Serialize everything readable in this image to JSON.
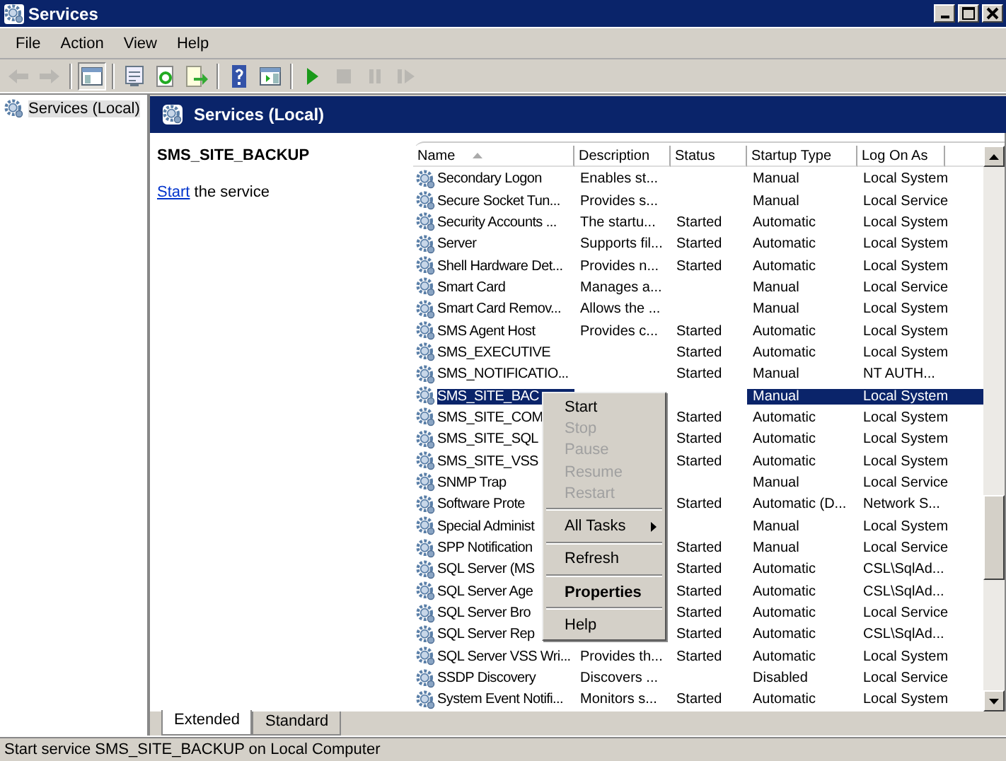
{
  "window": {
    "title": "Services"
  },
  "menu_bar": [
    "File",
    "Action",
    "View",
    "Help"
  ],
  "toolbar": [
    {
      "kind": "back",
      "disabled": true
    },
    {
      "kind": "forward",
      "disabled": true
    },
    {
      "kind": "sep"
    },
    {
      "kind": "tree",
      "disabled": false
    },
    {
      "kind": "sep"
    },
    {
      "kind": "props",
      "disabled": false
    },
    {
      "kind": "refresh",
      "disabled": false
    },
    {
      "kind": "export",
      "disabled": false
    },
    {
      "kind": "sep"
    },
    {
      "kind": "help",
      "disabled": false
    },
    {
      "kind": "pane",
      "disabled": false
    },
    {
      "kind": "sep"
    },
    {
      "kind": "play",
      "disabled": false
    },
    {
      "kind": "stop",
      "disabled": true
    },
    {
      "kind": "pause",
      "disabled": true
    },
    {
      "kind": "resume",
      "disabled": true
    }
  ],
  "tree": {
    "items": [
      {
        "label": "Services (Local)",
        "selected": true
      }
    ]
  },
  "header": {
    "title": "Services (Local)"
  },
  "details": {
    "title": "SMS_SITE_BACKUP",
    "link": "Start",
    "text": "the service"
  },
  "table": {
    "columns": [
      "Name",
      "Description",
      "Status",
      "Startup Type",
      "Log On As"
    ],
    "rows": [
      {
        "name": "Secondary Logon",
        "description": "Enables st...",
        "status": "",
        "startup": "Manual",
        "logon": "Local System",
        "selected": false
      },
      {
        "name": "Secure Socket Tun...",
        "description": "Provides s...",
        "status": "",
        "startup": "Manual",
        "logon": "Local Service",
        "selected": false
      },
      {
        "name": "Security Accounts ...",
        "description": "The startu...",
        "status": "Started",
        "startup": "Automatic",
        "logon": "Local System",
        "selected": false
      },
      {
        "name": "Server",
        "description": "Supports fil...",
        "status": "Started",
        "startup": "Automatic",
        "logon": "Local System",
        "selected": false
      },
      {
        "name": "Shell Hardware Det...",
        "description": "Provides n...",
        "status": "Started",
        "startup": "Automatic",
        "logon": "Local System",
        "selected": false
      },
      {
        "name": "Smart Card",
        "description": "Manages a...",
        "status": "",
        "startup": "Manual",
        "logon": "Local Service",
        "selected": false
      },
      {
        "name": "Smart Card Remov...",
        "description": "Allows the ...",
        "status": "",
        "startup": "Manual",
        "logon": "Local System",
        "selected": false
      },
      {
        "name": "SMS Agent Host",
        "description": "Provides c...",
        "status": "Started",
        "startup": "Automatic",
        "logon": "Local System",
        "selected": false
      },
      {
        "name": "SMS_EXECUTIVE",
        "description": "",
        "status": "Started",
        "startup": "Automatic",
        "logon": "Local System",
        "selected": false
      },
      {
        "name": "SMS_NOTIFICATIO...",
        "description": "",
        "status": "Started",
        "startup": "Manual",
        "logon": "NT AUTH...",
        "selected": false
      },
      {
        "name": "SMS_SITE_BAC",
        "description": "",
        "status": "",
        "startup": "Manual",
        "logon": "Local System",
        "selected": true
      },
      {
        "name": "SMS_SITE_COM",
        "description": "",
        "status": "Started",
        "startup": "Automatic",
        "logon": "Local System",
        "selected": false
      },
      {
        "name": "SMS_SITE_SQL",
        "description": "",
        "status": "Started",
        "startup": "Automatic",
        "logon": "Local System",
        "selected": false
      },
      {
        "name": "SMS_SITE_VSS",
        "description": "",
        "status": "Started",
        "startup": "Automatic",
        "logon": "Local System",
        "selected": false
      },
      {
        "name": "SNMP Trap",
        "description": "",
        "status": "",
        "startup": "Manual",
        "logon": "Local Service",
        "selected": false
      },
      {
        "name": "Software Prote",
        "description": "",
        "status": "Started",
        "startup": "Automatic (D...",
        "logon": "Network S...",
        "selected": false
      },
      {
        "name": "Special Administ",
        "description": "",
        "status": "",
        "startup": "Manual",
        "logon": "Local System",
        "selected": false
      },
      {
        "name": "SPP Notification",
        "description": "",
        "status": "Started",
        "startup": "Manual",
        "logon": "Local Service",
        "selected": false
      },
      {
        "name": "SQL Server (MS",
        "description": "",
        "status": "Started",
        "startup": "Automatic",
        "logon": "CSL\\SqlAd...",
        "selected": false
      },
      {
        "name": "SQL Server Age",
        "description": "",
        "status": "Started",
        "startup": "Automatic",
        "logon": "CSL\\SqlAd...",
        "selected": false
      },
      {
        "name": "SQL Server Bro",
        "description": "",
        "status": "Started",
        "startup": "Automatic",
        "logon": "Local Service",
        "selected": false
      },
      {
        "name": "SQL Server Rep",
        "description": "",
        "status": "Started",
        "startup": "Automatic",
        "logon": "CSL\\SqlAd...",
        "selected": false
      },
      {
        "name": "SQL Server VSS Wri...",
        "description": "Provides th...",
        "status": "Started",
        "startup": "Automatic",
        "logon": "Local System",
        "selected": false
      },
      {
        "name": "SSDP Discovery",
        "description": "Discovers ...",
        "status": "",
        "startup": "Disabled",
        "logon": "Local Service",
        "selected": false
      },
      {
        "name": "System Event Notifi...",
        "description": "Monitors s...",
        "status": "Started",
        "startup": "Automatic",
        "logon": "Local System",
        "selected": false
      }
    ]
  },
  "context_menu": [
    {
      "kind": "item",
      "label": "Start",
      "disabled": false
    },
    {
      "kind": "item",
      "label": "Stop",
      "disabled": true
    },
    {
      "kind": "item",
      "label": "Pause",
      "disabled": true
    },
    {
      "kind": "item",
      "label": "Resume",
      "disabled": true
    },
    {
      "kind": "item",
      "label": "Restart",
      "disabled": true
    },
    {
      "kind": "separator"
    },
    {
      "kind": "submenu",
      "label": "All Tasks",
      "disabled": false
    },
    {
      "kind": "separator"
    },
    {
      "kind": "item",
      "label": "Refresh",
      "disabled": false
    },
    {
      "kind": "separator"
    },
    {
      "kind": "default",
      "label": "Properties",
      "disabled": false
    },
    {
      "kind": "separator"
    },
    {
      "kind": "item",
      "label": "Help",
      "disabled": false
    }
  ],
  "view_tabs": [
    {
      "label": "Extended",
      "selected": true
    },
    {
      "label": "Standard",
      "selected": false
    }
  ],
  "status_bar": "Start service SMS_SITE_BACKUP on Local Computer"
}
